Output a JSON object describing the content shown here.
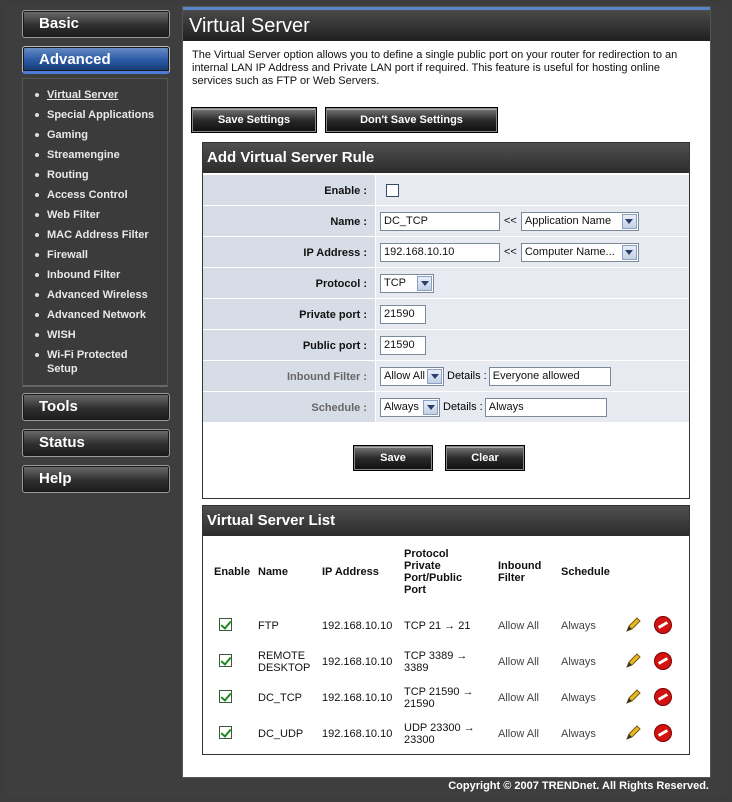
{
  "sidebar": {
    "basic": "Basic",
    "advanced": "Advanced",
    "items": [
      {
        "label": "Virtual Server"
      },
      {
        "label": "Special Applications"
      },
      {
        "label": "Gaming"
      },
      {
        "label": "Streamengine"
      },
      {
        "label": "Routing"
      },
      {
        "label": "Access Control"
      },
      {
        "label": "Web Filter"
      },
      {
        "label": "MAC Address Filter"
      },
      {
        "label": "Firewall"
      },
      {
        "label": "Inbound Filter"
      },
      {
        "label": "Advanced Wireless"
      },
      {
        "label": "Advanced Network"
      },
      {
        "label": "WISH"
      },
      {
        "label": "Wi-Fi Protected Setup"
      }
    ],
    "tools": "Tools",
    "status": "Status",
    "help": "Help"
  },
  "page": {
    "title": "Virtual Server",
    "description": "The Virtual Server option allows you to define a single public port on your router for redirection to an internal LAN IP Address and Private LAN port if required. This feature is useful for hosting online services such as FTP or Web Servers.",
    "save_settings": "Save Settings",
    "dont_save_settings": "Don't Save Settings"
  },
  "rule_form": {
    "title": "Add Virtual Server Rule",
    "enable_label": "Enable :",
    "name_label": "Name :",
    "name_value": "DC_TCP",
    "name_arrow": "<<",
    "name_select": "Application Name",
    "ip_label": "IP Address :",
    "ip_value": "192.168.10.10",
    "ip_arrow": "<<",
    "ip_select": "Computer Name...",
    "protocol_label": "Protocol :",
    "protocol_value": "TCP",
    "private_port_label": "Private port :",
    "private_port_value": "21590",
    "public_port_label": "Public port :",
    "public_port_value": "21590",
    "inbound_label": "Inbound Filter :",
    "inbound_value": "Allow All",
    "inbound_details_label": "Details :",
    "inbound_details_value": "Everyone allowed",
    "schedule_label": "Schedule :",
    "schedule_value": "Always",
    "schedule_details_label": "Details :",
    "schedule_details_value": "Always",
    "save": "Save",
    "clear": "Clear"
  },
  "server_list": {
    "title": "Virtual Server List",
    "headers": {
      "enable": "Enable",
      "name": "Name",
      "ip": "IP Address",
      "protocol_l1": "Protocol",
      "protocol_l2": "Private",
      "protocol_l3": "Port/Public",
      "protocol_l4": "Port",
      "inbound_l1": "Inbound",
      "inbound_l2": "Filter",
      "schedule": "Schedule"
    },
    "rows": [
      {
        "name_l1": "FTP",
        "name_l2": "",
        "ip": "192.168.10.10",
        "proto_l1": "TCP 21 → 21",
        "proto_l2": "",
        "inbound": "Allow All",
        "schedule": "Always"
      },
      {
        "name_l1": "REMOTE",
        "name_l2": "DESKTOP",
        "ip": "192.168.10.10",
        "proto_l1": "TCP 3389 →",
        "proto_l2": "3389",
        "inbound": "Allow All",
        "schedule": "Always"
      },
      {
        "name_l1": "DC_TCP",
        "name_l2": "",
        "ip": "192.168.10.10",
        "proto_l1": "TCP 21590 →",
        "proto_l2": "21590",
        "inbound": "Allow All",
        "schedule": "Always"
      },
      {
        "name_l1": "DC_UDP",
        "name_l2": "",
        "ip": "192.168.10.10",
        "proto_l1": "UDP 23300 →",
        "proto_l2": "23300",
        "inbound": "Allow All",
        "schedule": "Always"
      }
    ]
  },
  "footer": "Copyright © 2007 TRENDnet. All Rights Reserved.",
  "icons": {
    "edit": "pencil-icon",
    "delete": "delete-icon"
  },
  "colors": {
    "accent": "#4a7cd8",
    "delete": "#d41212",
    "check": "#1a8a1a"
  }
}
